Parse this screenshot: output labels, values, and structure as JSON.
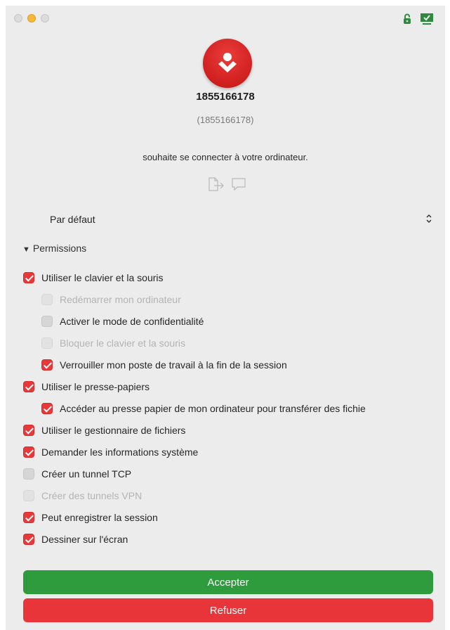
{
  "window": {
    "traffic_lights": [
      "close",
      "minimize",
      "maximize"
    ]
  },
  "status_icons": [
    "lock-icon",
    "screen-icon"
  ],
  "colors": {
    "accent_red": "#e8393a",
    "accept_green": "#2e9b3c",
    "refuse_red": "#e8353a",
    "background": "#ececec"
  },
  "caller": {
    "name": "1855166178",
    "id": "(1855166178)",
    "message": "souhaite se connecter à votre ordinateur."
  },
  "action_icons": [
    "file-transfer-icon",
    "chat-icon"
  ],
  "profile": {
    "selected": "Par défaut"
  },
  "permissions": {
    "header": "Permissions",
    "items": [
      {
        "label": "Utiliser le clavier et la souris",
        "state": "checked",
        "indent": 0
      },
      {
        "label": "Redémarrer mon ordinateur",
        "state": "disabled",
        "indent": 1
      },
      {
        "label": "Activer le mode de confidentialité",
        "state": "unchecked",
        "indent": 1
      },
      {
        "label": "Bloquer le clavier et la souris",
        "state": "disabled",
        "indent": 1
      },
      {
        "label": "Verrouiller mon poste de travail à la fin de la session",
        "state": "checked",
        "indent": 1
      },
      {
        "label": "Utiliser le presse-papiers",
        "state": "checked",
        "indent": 0
      },
      {
        "label": "Accéder au presse papier de mon ordinateur pour transférer des fichie",
        "state": "checked",
        "indent": 1
      },
      {
        "label": "Utiliser le gestionnaire de fichiers",
        "state": "checked",
        "indent": 0
      },
      {
        "label": "Demander les informations système",
        "state": "checked",
        "indent": 0
      },
      {
        "label": "Créer un tunnel TCP",
        "state": "unchecked",
        "indent": 0
      },
      {
        "label": "Créer des tunnels VPN",
        "state": "disabled",
        "indent": 0
      },
      {
        "label": "Peut enregistrer la session",
        "state": "checked",
        "indent": 0
      },
      {
        "label": "Dessiner sur l'écran",
        "state": "checked",
        "indent": 0
      }
    ]
  },
  "buttons": {
    "accept": "Accepter",
    "refuse": "Refuser"
  }
}
